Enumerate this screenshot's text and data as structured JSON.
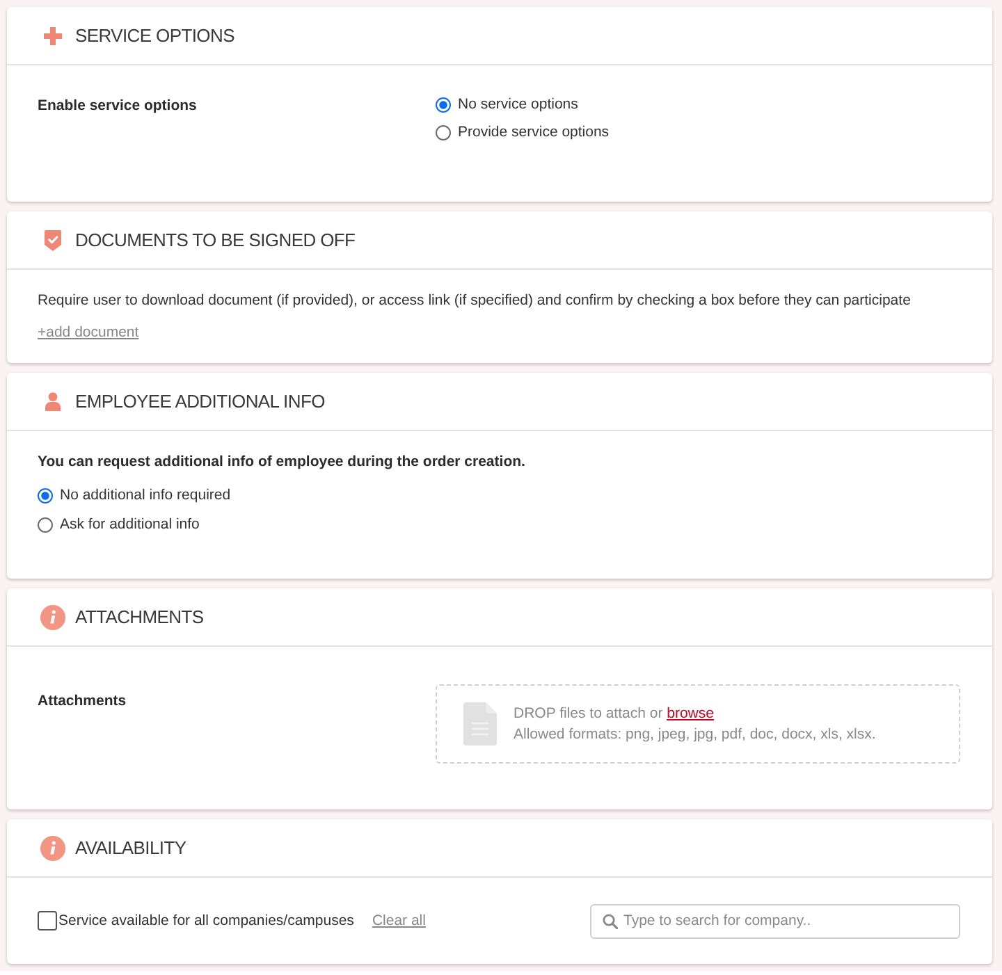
{
  "service_options": {
    "title": "SERVICE OPTIONS",
    "label": "Enable service options",
    "options": [
      {
        "label": "No service options",
        "selected": true
      },
      {
        "label": "Provide service options",
        "selected": false
      }
    ]
  },
  "documents": {
    "title": "DOCUMENTS TO BE SIGNED OFF",
    "description": "Require user to download document (if provided), or access link (if specified) and confirm by checking a box before they can participate",
    "add_link": "+add document"
  },
  "employee_info": {
    "title": "EMPLOYEE ADDITIONAL INFO",
    "description": "You can request additional info of employee during the order creation.",
    "options": [
      {
        "label": "No additional info required",
        "selected": true
      },
      {
        "label": "Ask for additional info",
        "selected": false
      }
    ]
  },
  "attachments": {
    "title": "ATTACHMENTS",
    "label": "Attachments",
    "dropzone": {
      "text": "DROP files to attach or",
      "link": "browse",
      "formats": "Allowed formats: png, jpeg, jpg, pdf, doc, docx, xls, xlsx."
    }
  },
  "availability": {
    "title": "AVAILABILITY",
    "checkbox": {
      "label": "Service available for all companies/campuses",
      "checked": false
    },
    "clear_link": "Clear all",
    "search": {
      "placeholder": "Type to search for company.."
    }
  }
}
